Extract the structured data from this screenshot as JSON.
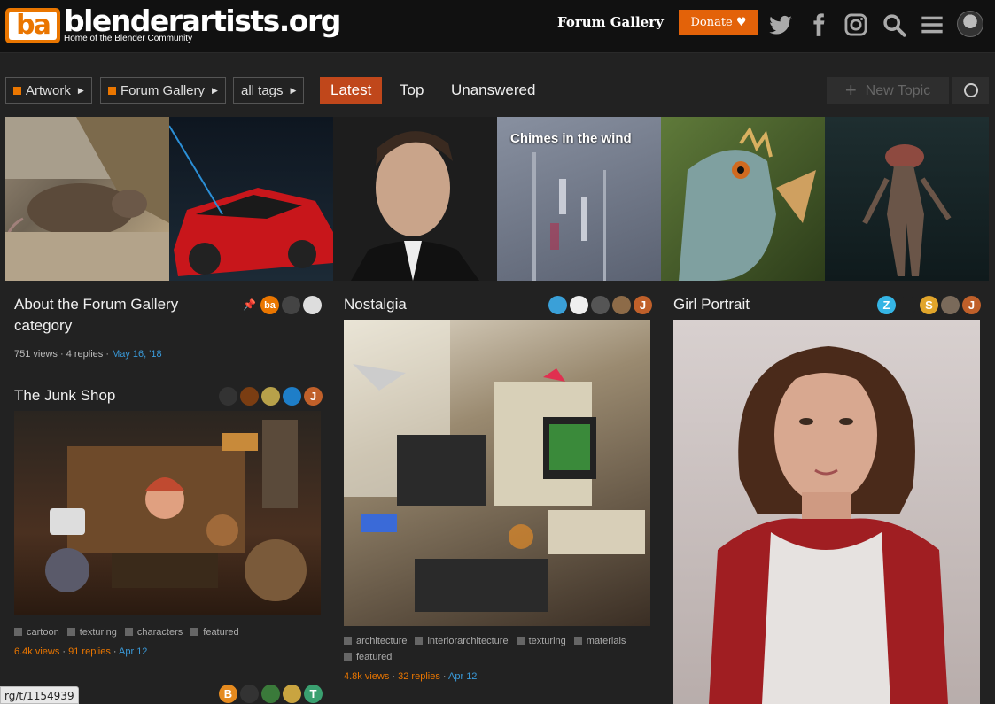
{
  "header": {
    "logo_text": "ba",
    "site_name": "blenderartists.org",
    "tagline": "Home of the Blender Community",
    "forum_gallery_link": "Forum Gallery",
    "donate_label": "Donate ♥",
    "icons": [
      "twitter-icon",
      "facebook-icon",
      "instagram-icon",
      "search-icon",
      "hamburger-menu-icon",
      "user-avatar"
    ]
  },
  "nav": {
    "breadcrumbs": [
      {
        "label": "Artwork",
        "color": "#ea7600"
      },
      {
        "label": "Forum Gallery",
        "color": "#ea7600"
      },
      {
        "label": "all tags"
      }
    ],
    "tabs": [
      {
        "label": "Latest",
        "active": true
      },
      {
        "label": "Top"
      },
      {
        "label": "Unanswered"
      }
    ],
    "new_topic_label": "New Topic"
  },
  "banner": {
    "tiles": [
      {
        "subject": "rat on sack"
      },
      {
        "subject": "red sports car"
      },
      {
        "subject": "man in suit portrait"
      },
      {
        "subject": "wind chimes",
        "caption": "Chimes in the wind"
      },
      {
        "subject": "iguana"
      },
      {
        "subject": "demogorgon creature"
      }
    ]
  },
  "topics": {
    "about": {
      "title_line1": "About the Forum Gallery",
      "title_line2": "category",
      "views": "751 views",
      "replies": "4 replies",
      "date": "May 16, '18",
      "posters": [
        {
          "text": "ba",
          "color": "#ea7600"
        },
        {
          "text": "",
          "color": "#444"
        },
        {
          "text": "",
          "color": "#ddd"
        }
      ]
    },
    "junk_shop": {
      "title": "The Junk Shop",
      "tags": [
        "cartoon",
        "texturing",
        "characters",
        "featured"
      ],
      "views": "6.4k views",
      "replies": "91 replies",
      "date": "Apr 12",
      "posters": [
        {
          "text": "",
          "color": "#333"
        },
        {
          "text": "",
          "color": "#7a3d12"
        },
        {
          "text": "",
          "color": "#b7a14a"
        },
        {
          "text": "",
          "color": "#1e7ec8"
        },
        {
          "text": "J",
          "color": "#c0602a"
        }
      ]
    },
    "nostalgia": {
      "title": "Nostalgia",
      "tags": [
        "architecture",
        "interiorarchitecture",
        "texturing",
        "materials",
        "featured"
      ],
      "views": "4.8k views",
      "replies": "32 replies",
      "date": "Apr 12",
      "posters": [
        {
          "text": "",
          "color": "#3aa0d8"
        },
        {
          "text": "",
          "color": "#eee"
        },
        {
          "text": "",
          "color": "#555"
        },
        {
          "text": "",
          "color": "#8d6b48"
        },
        {
          "text": "J",
          "color": "#c0602a"
        }
      ]
    },
    "girl_portrait": {
      "title": "Girl Portrait",
      "posters": [
        {
          "text": "Z",
          "color": "#35b5e5"
        },
        {
          "text": "",
          "color": "#222"
        },
        {
          "text": "S",
          "color": "#e1a52b"
        },
        {
          "text": "",
          "color": "#7a6a5a"
        },
        {
          "text": "J",
          "color": "#c0602a"
        }
      ]
    },
    "next_row": {
      "posters": [
        {
          "text": "B",
          "color": "#e58a1f"
        },
        {
          "text": "",
          "color": "#333"
        },
        {
          "text": "",
          "color": "#3a7a3a"
        },
        {
          "text": "",
          "color": "#c9a440"
        },
        {
          "text": "T",
          "color": "#3aa070"
        }
      ]
    }
  },
  "status_bar": {
    "url_text": "rg/t/1154939"
  }
}
